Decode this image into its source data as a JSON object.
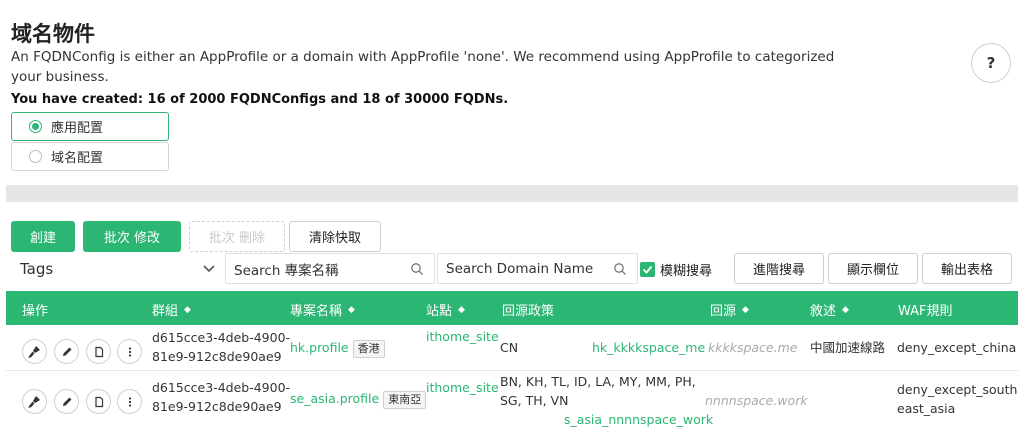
{
  "page": {
    "title": "域名物件",
    "description": "An FQDNConfig is either an AppProfile or a domain with AppProfile 'none'. We recommend using AppProfile to categorized your business.",
    "created_summary": "You have created: 16 of 2000 FQDNConfigs and 18 of 30000 FQDNs.",
    "help_label": "?"
  },
  "view_options": [
    {
      "label": "應用配置",
      "selected": true
    },
    {
      "label": "域名配置",
      "selected": false
    }
  ],
  "toolbar": {
    "create_label": "創建",
    "batch_edit_label": "批次 修改",
    "batch_delete_label": "批次 刪除",
    "clear_cache_label": "清除快取",
    "tags_label": "Tags",
    "search_project_placeholder": "Search 專案名稱",
    "search_domain_placeholder": "Search Domain Name",
    "fuzzy_label": "模糊搜尋",
    "advanced_search_label": "進階搜尋",
    "show_columns_label": "顯示欄位",
    "export_label": "輸出表格"
  },
  "table": {
    "headers": [
      "操作",
      "群組",
      "專案名稱",
      "站點",
      "回源政策",
      "回源",
      "敘述",
      "WAF規則"
    ],
    "rows": [
      {
        "group": "d615cce3-4deb-4900-81e9-912c8de90ae9",
        "group_line1": "d615cce3-4deb-4900-",
        "group_line2": "81e9-912c8de90ae9",
        "project": "hk.profile",
        "region_tag": "香港",
        "site": "ithome_site",
        "policy": "CN",
        "policy_name": "hk_kkkkspace_me",
        "origin": "kkkkspace.me",
        "description": "中國加速線路",
        "waf": "deny_except_china"
      },
      {
        "group": "d615cce3-4deb-4900-81e9-912c8de90ae9",
        "group_line1": "d615cce3-4deb-4900-",
        "group_line2": "81e9-912c8de90ae9",
        "project": "se_asia.profile",
        "region_tag": "東南亞",
        "site": "ithome_site",
        "policy_line1": "BN, KH, TL, ID, LA, MY, MM, PH,",
        "policy_line2": "SG, TH, VN",
        "policy_name": "s_asia_nnnnspace_work",
        "origin": "nnnnspace.work",
        "description": "",
        "waf_line1": "deny_except_south",
        "waf_line2": "east_asia"
      }
    ]
  },
  "colors": {
    "accent": "#2bb673"
  }
}
